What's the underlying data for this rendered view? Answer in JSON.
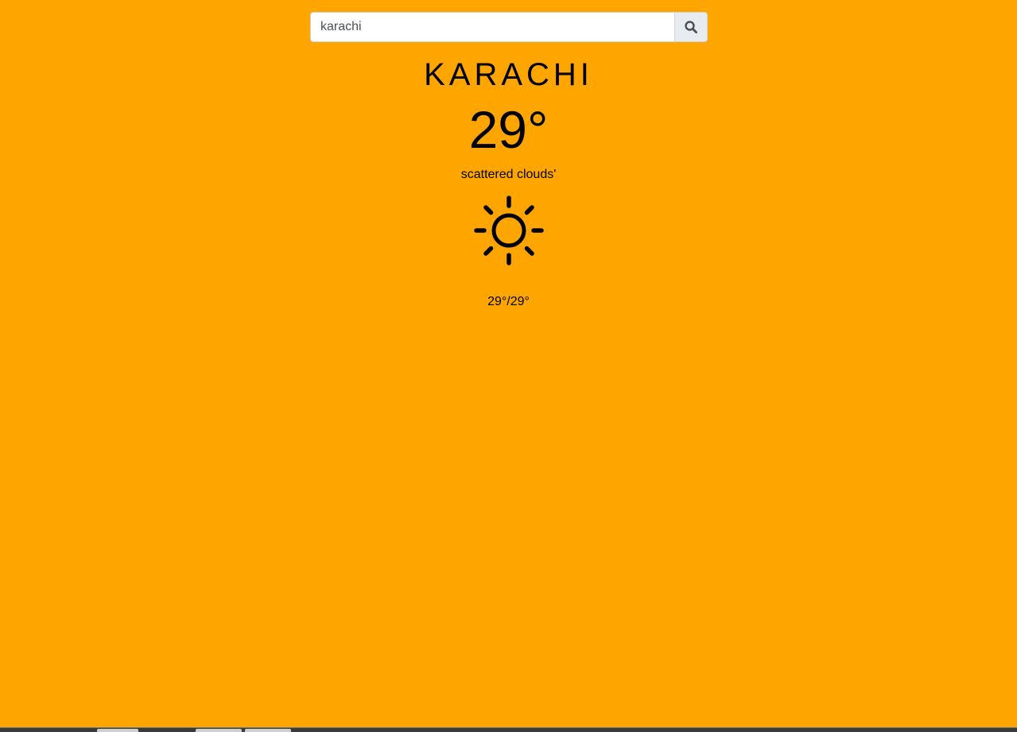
{
  "search": {
    "value": "karachi",
    "button_icon": "search-icon"
  },
  "weather": {
    "city": "KARACHI",
    "temperature": "29°",
    "description": "scattered clouds'",
    "icon": "sun-icon",
    "min_max": "29°/29°"
  },
  "colors": {
    "background": "#FFA500",
    "text": "#000000"
  }
}
